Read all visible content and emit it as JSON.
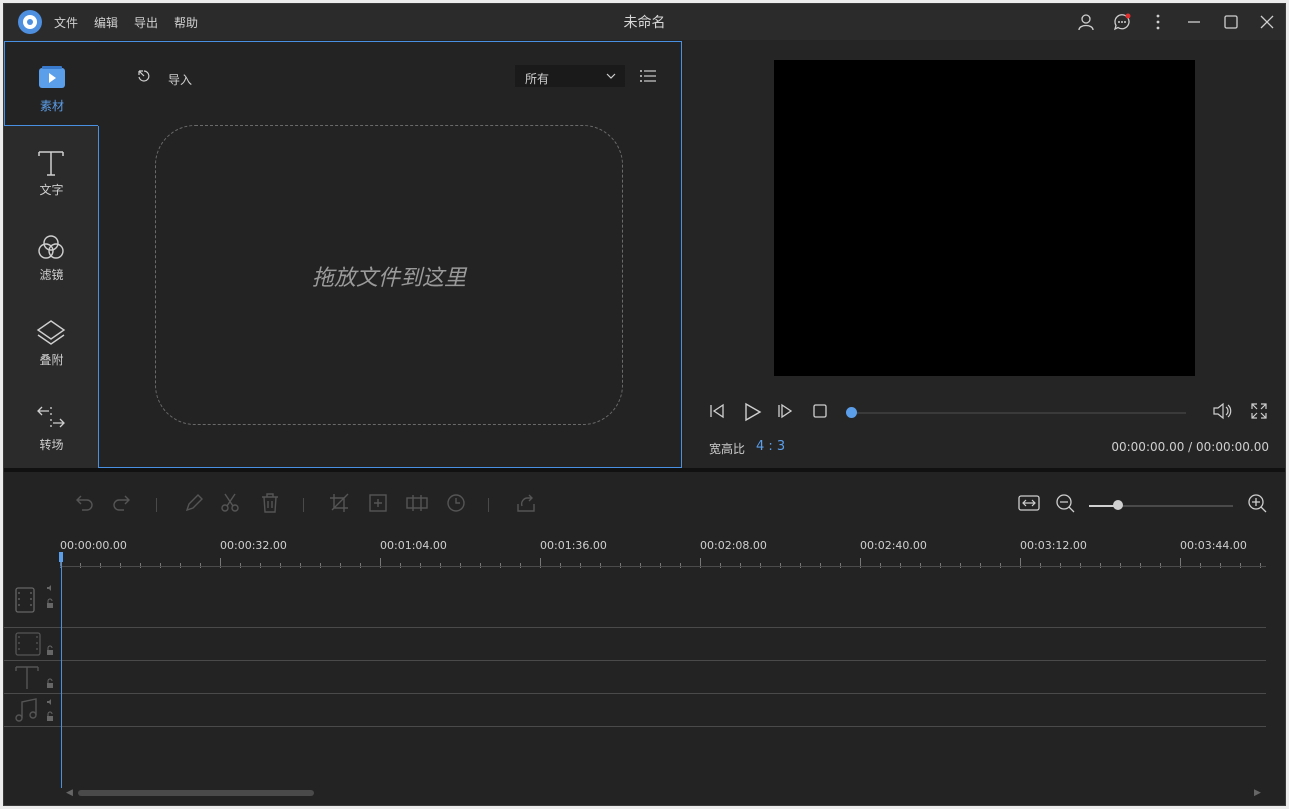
{
  "window": {
    "title": "未命名"
  },
  "menu": [
    "文件",
    "编辑",
    "导出",
    "帮助"
  ],
  "sidebar": {
    "items": [
      {
        "label": "素材",
        "icon": "media-icon",
        "active": true
      },
      {
        "label": "文字",
        "icon": "text-icon",
        "active": false
      },
      {
        "label": "滤镜",
        "icon": "filter-icon",
        "active": false
      },
      {
        "label": "叠附",
        "icon": "overlay-icon",
        "active": false
      },
      {
        "label": "转场",
        "icon": "transition-icon",
        "active": false
      }
    ]
  },
  "media": {
    "import_label": "导入",
    "filter_selected": "所有",
    "dropzone_text": "拖放文件到这里"
  },
  "preview": {
    "ratio_label": "宽高比",
    "ratio_value": "4 : 3",
    "timecode": "00:00:00.00 / 00:00:00.00",
    "progress": 0
  },
  "timeline": {
    "ticks": [
      "00:00:00.00",
      "00:00:32.00",
      "00:01:04.00",
      "00:01:36.00",
      "00:02:08.00",
      "00:02:40.00",
      "00:03:12.00",
      "00:03:44.00"
    ],
    "tracks": [
      "video-track",
      "overlay-track",
      "text-track",
      "audio-track"
    ]
  },
  "colors": {
    "accent": "#4a90e2",
    "background": "#232323",
    "notification": "#e03030"
  }
}
